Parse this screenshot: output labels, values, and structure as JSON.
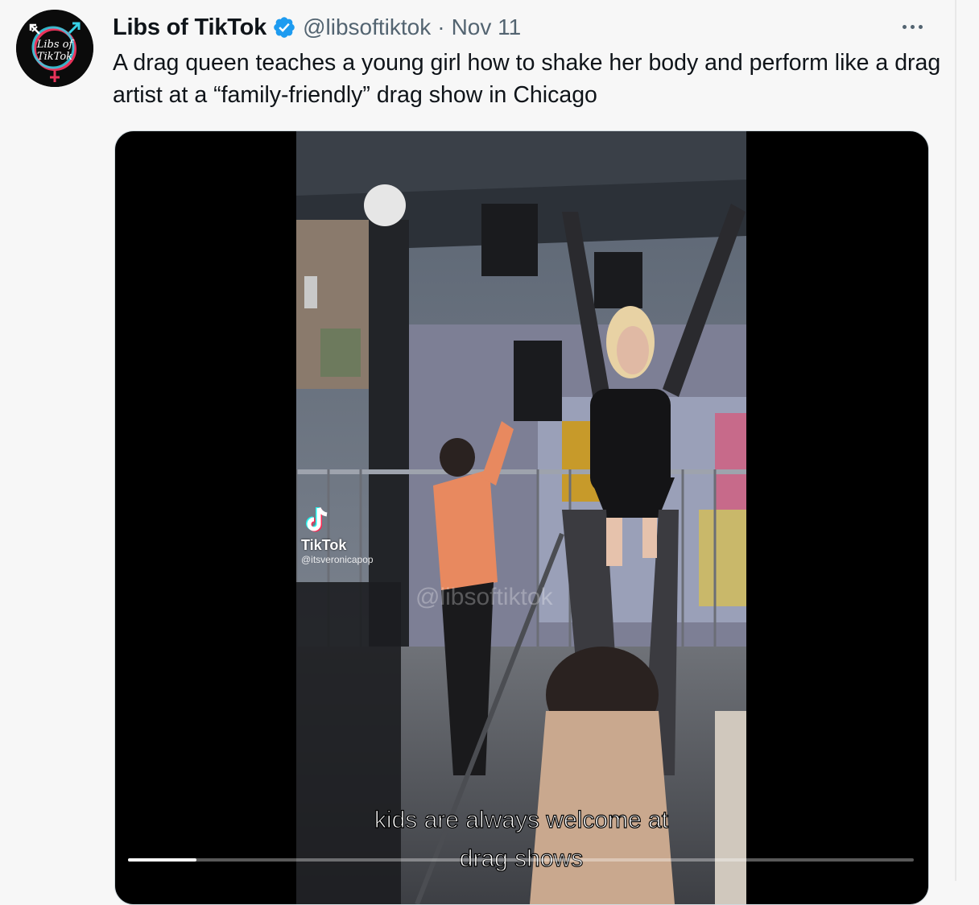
{
  "author": {
    "display_name": "Libs of TikTok",
    "handle": "@libsoftiktok",
    "separator": "·",
    "date": "Nov 11",
    "avatar_text_line1": "Libs of",
    "avatar_text_line2": "TikTok"
  },
  "tweet": {
    "text": "A drag queen teaches a young girl how to shake her body and perform like a drag artist at a “family-friendly” drag show in Chicago"
  },
  "video": {
    "tiktok_brand": "TikTok",
    "tiktok_user": "@itsveronicapop",
    "watermark": "@libsoftiktok",
    "caption_line1": "kids are always welcome at",
    "caption_line2": "drag shows",
    "progress": 0.087
  },
  "colors": {
    "verified_blue": "#1d9bf0",
    "secondary_text": "#536471",
    "background": "#f7f7f7"
  },
  "icons": {
    "verified": "verified-badge-icon",
    "more": "more-options-icon",
    "tiktok": "tiktok-note-icon"
  }
}
